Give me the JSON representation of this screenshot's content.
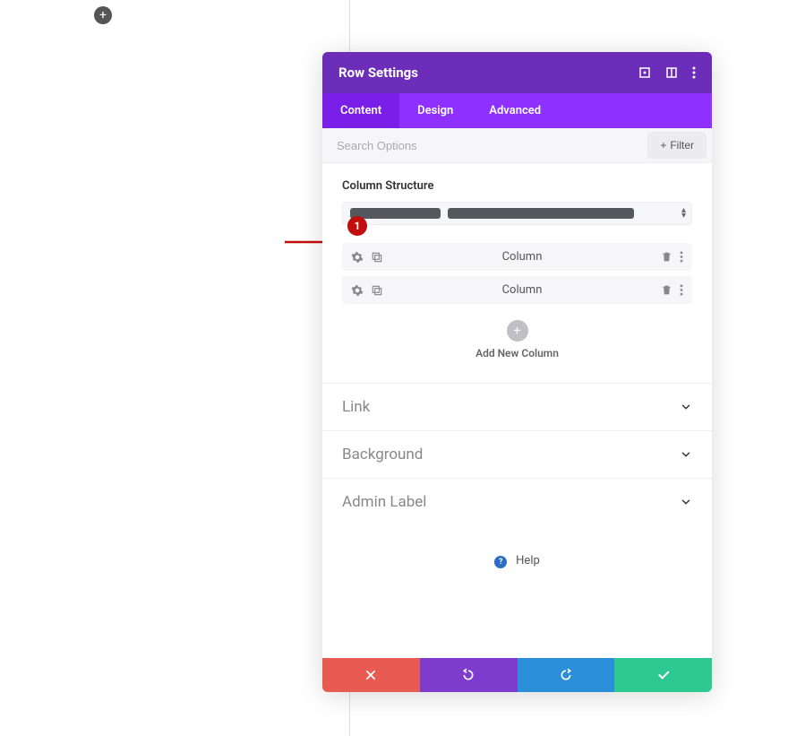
{
  "page": {
    "add_button_icon": "+"
  },
  "annotation": {
    "number": "1"
  },
  "modal": {
    "title": "Row Settings",
    "tabs": {
      "content": "Content",
      "design": "Design",
      "advanced": "Advanced",
      "active": "content"
    },
    "search": {
      "placeholder": "Search Options"
    },
    "filter": {
      "label": "Filter"
    },
    "column_structure": {
      "label": "Column Structure"
    },
    "columns": [
      {
        "label": "Column"
      },
      {
        "label": "Column"
      }
    ],
    "add_column": {
      "icon": "+",
      "label": "Add New Column"
    },
    "accordions": {
      "link": "Link",
      "background": "Background",
      "admin_label": "Admin Label"
    },
    "help": {
      "label": "Help"
    }
  },
  "colors": {
    "header_purple": "#6c2eb9",
    "tabs_purple": "#8e30ff",
    "cancel_red": "#e85b52",
    "undo_purple": "#7d3cce",
    "redo_blue": "#2a8fd8",
    "save_green": "#2ec991",
    "annotation_red": "#c10d0d"
  }
}
